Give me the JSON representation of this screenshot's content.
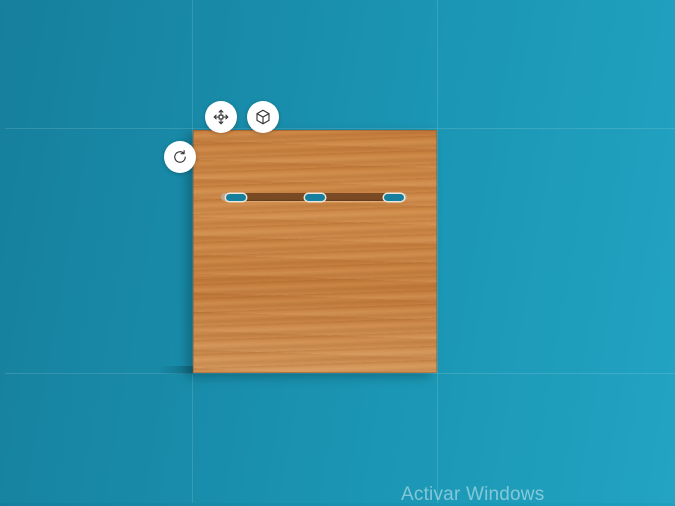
{
  "icons": {
    "move": "move-arrows-icon",
    "view3d": "cube-icon",
    "rotate": "rotate-icon"
  },
  "colors": {
    "background": "#1a94b2",
    "wood": "#cf8a49",
    "rail": "#7a4a24"
  },
  "watermark": {
    "text": "Activar Windows"
  }
}
